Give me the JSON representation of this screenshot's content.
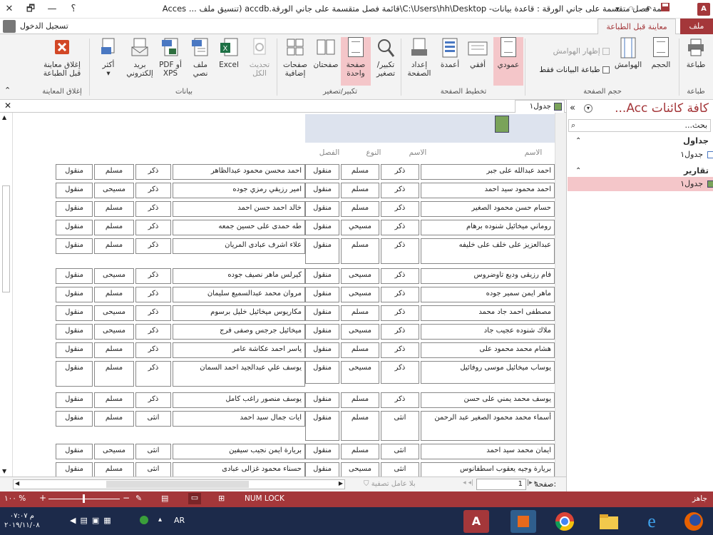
{
  "titlebar": {
    "title": "قائمة فصل متقسمة على جاني الورقة : قاعدة بيانات- C:\\Users\\hh\\Desktop\\قائمة فصل متقسمة على جاني الورقة.accdb (تنسيق ملف ... Acces",
    "help": "؟",
    "minimize": "—",
    "restore": "🗗",
    "close": "✕",
    "app_icon_label": "A"
  },
  "tabs": {
    "file": "ملف",
    "print_preview": "معاينة قبل الطباعة",
    "signin": "تسجيل الدخول"
  },
  "ribbon": {
    "print": "طباعة",
    "size": "الحجم",
    "margins": "الهوامش",
    "show_margins": "إظهار الهوامش",
    "print_data_only": "طباعة البيانات فقط",
    "portrait": "عمودي",
    "landscape": "أفقي",
    "columns": "أعمدة",
    "page_setup": "إعداد الصفحة",
    "zoom": "تكبير/تصغير",
    "one_page": "صفحة واحدة",
    "two_pages": "صفحتان",
    "more_pages": "صفحات إضافية",
    "refresh_all": "تحديث الكل",
    "excel": "Excel",
    "text_file": "ملف نصي",
    "pdf_xps": "PDF أو XPS",
    "email": "بريد إلكتروني",
    "more": "أكثر",
    "close_preview": "إغلاق معاينة قبل الطباعة",
    "groups": {
      "print": "طباعة",
      "page_size": "حجم الصفحة",
      "page_layout": "تخطيط الصفحة",
      "zoom": "تكبير/تصغير",
      "data": "بيانات",
      "close_preview": "إغلاق المعاينة"
    }
  },
  "navpane": {
    "title": "كافة كائنات Acc...",
    "search_placeholder": "بحث...",
    "groups": [
      {
        "name": "جداول",
        "items": [
          "جدول١"
        ]
      },
      {
        "name": "تقارير",
        "items": [
          "جدول١"
        ]
      }
    ]
  },
  "document": {
    "tab": "جدول١",
    "close": "✕"
  },
  "report": {
    "headers": {
      "name": "الاسم",
      "religion": "الاسم",
      "gender": "النوع",
      "class": "الفصل"
    },
    "right_rows": [
      [
        "احمد عبدالله على جبر",
        "ذكر",
        "مسلم",
        "منقول"
      ],
      [
        "احمد محمود سيد احمد",
        "ذكر",
        "مسلم",
        "منقول"
      ],
      [
        "حسام حسن محمود الصغير",
        "ذكر",
        "مسلم",
        "منقول"
      ],
      [
        "روماني ميخائيل شنوده برهام",
        "ذكر",
        "مسيحي",
        "منقول"
      ],
      [
        "عبدالعزيز على خلف على خليفه",
        "ذكر",
        "مسلم",
        "منقول"
      ],
      [
        "فام رزيقى وديع تاوضروس",
        "ذكر",
        "مسيحى",
        "منقول"
      ],
      [
        "ماهر ايمن سمير جوده",
        "ذكر",
        "مسيحى",
        "منقول"
      ],
      [
        "مصطفى احمد جاد محمد",
        "ذكر",
        "مسلم",
        "منقول"
      ],
      [
        "ملاك شنوده عجيب جاد",
        "ذكر",
        "مسيحى",
        "منقول"
      ],
      [
        "هشام محمد محمود على",
        "ذكر",
        "مسلم",
        "منقول"
      ],
      [
        "يوساب ميخائيل موسى روفائيل",
        "ذكر",
        "مسيحى",
        "منقول"
      ],
      [
        "يوسف محمد يمني على حسن",
        "ذكر",
        "مسلم",
        "منقول"
      ],
      [
        "أسماء محمد محمود الصغير عبد الرحمن",
        "انثى",
        "مسلم",
        "منقول"
      ],
      [
        "ايمان محمد سيد احمد",
        "انثى",
        "مسلم",
        "منقول"
      ],
      [
        "بريارة وجيه يعقوب اسطفانوس",
        "انثى",
        "مسيحى",
        "منقول"
      ]
    ],
    "left_rows": [
      [
        "احمد محسن محمود عبدالظاهر",
        "ذكر",
        "مسلم",
        "منقول"
      ],
      [
        "امير رزيقي رمزي جوده",
        "ذكر",
        "مسيحى",
        "منقول"
      ],
      [
        "خالد احمد حسن احمد",
        "ذكر",
        "مسلم",
        "منقول"
      ],
      [
        "طه حمدى على حسين جمعه",
        "ذكر",
        "مسلم",
        "منقول"
      ],
      [
        "علاء اشرف عبادى المريان",
        "ذكر",
        "مسلم",
        "منقول"
      ],
      [
        "كيرلس ماهر نصيف جوده",
        "ذكر",
        "مسيحى",
        "منقول"
      ],
      [
        "مروان محمد عبدالسميع سليمان",
        "ذكر",
        "مسلم",
        "منقول"
      ],
      [
        "مكاريوس ميخائيل خليل برسوم",
        "ذكر",
        "مسيحى",
        "منقول"
      ],
      [
        "ميخائيل جرجس وصفى فرج",
        "ذكر",
        "مسيحى",
        "منقول"
      ],
      [
        "ياسر احمد عكاشة عامر",
        "ذكر",
        "مسلم",
        "منقول"
      ],
      [
        "يوسف علي عبدالجيد احمد السمان",
        "ذكر",
        "مسلم",
        "منقول"
      ],
      [
        "يوسف منصور راغب كامل",
        "ذكر",
        "مسلم",
        "منقول"
      ],
      [
        "ايات جمال سيد احمد",
        "انثى",
        "مسلم",
        "منقول"
      ],
      [
        "بريارة ايمن نجيب سيفين",
        "انثى",
        "مسيحى",
        "منقول"
      ],
      [
        "حسناء محمود غزالى عبادى",
        "انثى",
        "مسلم",
        "منقول"
      ]
    ]
  },
  "pager": {
    "label": "صفحة:",
    "page": "1",
    "filter": "بلا عامل تصفية"
  },
  "status": {
    "ready": "جاهز",
    "numlock": "NUM LOCK",
    "zoom": "١٠٠ %"
  },
  "taskbar": {
    "time": "م ٠٧:٠٧",
    "date": "٢٠١٩/١١/٠٨",
    "lang": "AR"
  },
  "colors": {
    "accent": "#a4373a",
    "selected": "#f4c6c9",
    "taskbar": "#1c2a4a"
  }
}
